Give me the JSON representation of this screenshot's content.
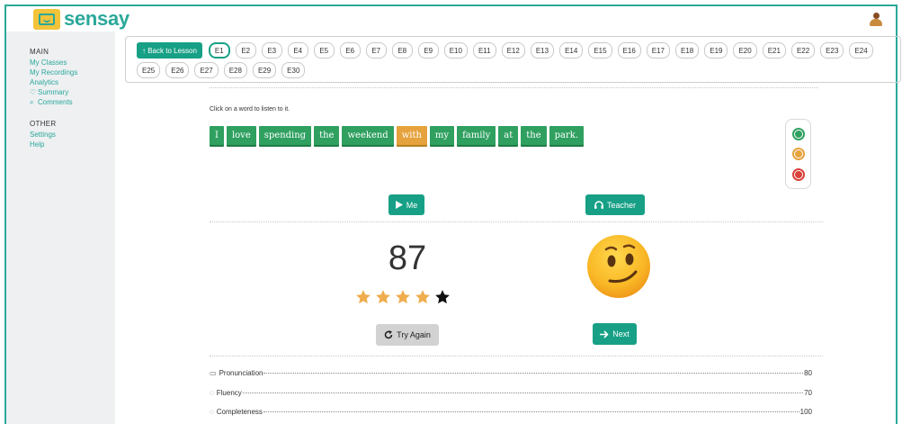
{
  "app": {
    "name": "sensay"
  },
  "sidebar": {
    "main_heading": "MAIN",
    "main_items": [
      {
        "label": "My Classes",
        "icon": ""
      },
      {
        "label": "My Recordings",
        "icon": ""
      },
      {
        "label": "Analytics",
        "icon": ""
      },
      {
        "label": "Summary",
        "icon": "trophy-icon"
      },
      {
        "label": "Comments",
        "icon": "comments-icon"
      }
    ],
    "other_heading": "OTHER",
    "other_items": [
      {
        "label": "Settings"
      },
      {
        "label": "Help"
      }
    ]
  },
  "exercise_bar": {
    "back_label": "↑ Back to Lesson",
    "active": "E1",
    "items": [
      "E1",
      "E2",
      "E3",
      "E4",
      "E5",
      "E6",
      "E7",
      "E8",
      "E9",
      "E10",
      "E11",
      "E12",
      "E13",
      "E14",
      "E15",
      "E16",
      "E17",
      "E18",
      "E19",
      "E20",
      "E21",
      "E22",
      "E23",
      "E24",
      "E25",
      "E26",
      "E27",
      "E28",
      "E29",
      "E30"
    ]
  },
  "sentence": {
    "instruction": "Click on a word to listen to it.",
    "words": [
      {
        "text": "I",
        "state": "good"
      },
      {
        "text": "love",
        "state": "good"
      },
      {
        "text": "spending",
        "state": "good"
      },
      {
        "text": "the",
        "state": "good"
      },
      {
        "text": "weekend",
        "state": "good"
      },
      {
        "text": "with",
        "state": "ok"
      },
      {
        "text": "my",
        "state": "good"
      },
      {
        "text": "family",
        "state": "good"
      },
      {
        "text": "at",
        "state": "good"
      },
      {
        "text": "the",
        "state": "good"
      },
      {
        "text": "park.",
        "state": "good"
      }
    ]
  },
  "legend": {
    "faces": [
      {
        "name": "good-face-icon",
        "color": "#2fa060"
      },
      {
        "name": "ok-face-icon",
        "color": "#e6a23c"
      },
      {
        "name": "bad-face-icon",
        "color": "#d9413a"
      }
    ]
  },
  "playback": {
    "me_label": "Me",
    "teacher_label": "Teacher"
  },
  "result": {
    "score": "87",
    "stars": 4,
    "stars_max": 5,
    "try_again_label": "Try Again",
    "next_label": "Next"
  },
  "metrics": [
    {
      "label": "Pronunciation",
      "value": "80",
      "icon": "speech-bubble-icon"
    },
    {
      "label": "Fluency",
      "value": "70",
      "icon": "chat-icon"
    },
    {
      "label": "Completeness",
      "value": "100",
      "icon": "chat-icon"
    }
  ],
  "colors": {
    "accent": "#17a086",
    "brand": "#2aa89a",
    "good": "#2fa060",
    "ok": "#e6a23c",
    "bad": "#d9413a",
    "star": "#f0ad4e"
  }
}
